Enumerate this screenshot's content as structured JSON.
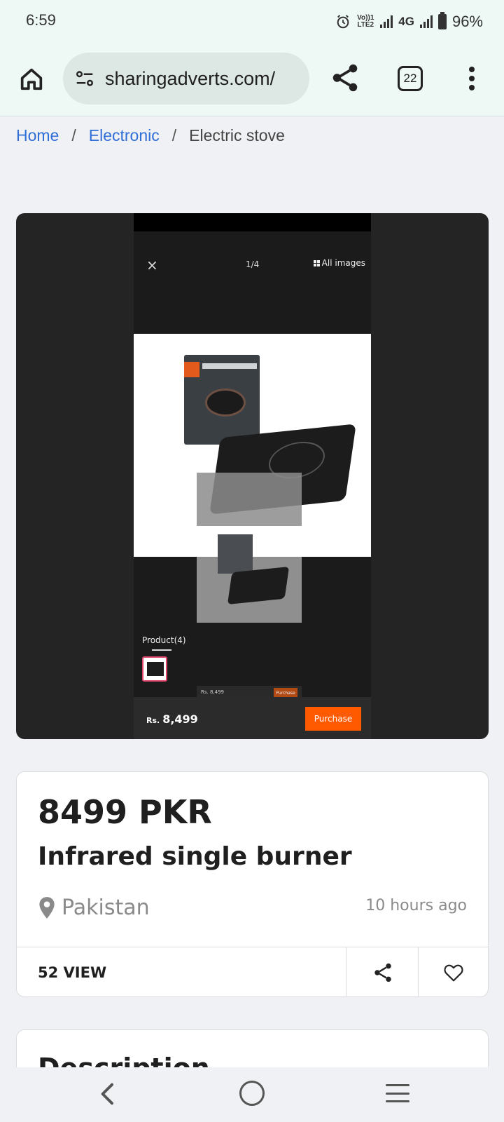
{
  "status_bar": {
    "time": "6:59",
    "volte_label": "Vo))1 LTE2",
    "network": "4G",
    "battery": "96%",
    "icons": [
      "alarm-icon",
      "signal-icon",
      "battery-icon"
    ]
  },
  "browser": {
    "url": "sharingadverts.com/",
    "tab_count": "22",
    "icons": [
      "home-icon",
      "site-settings-icon",
      "share-icon",
      "tabs-icon",
      "more-menu-icon"
    ]
  },
  "breadcrumb": {
    "items": [
      "Home",
      "Electronic"
    ],
    "current": "Electric stove",
    "separator": "/"
  },
  "embedded_image": {
    "close": "×",
    "counter": "1/4",
    "all_images": "All images",
    "product_count": "Product(4)",
    "mini_price": "Rs. 8,499",
    "mini_purchase": "Purchase",
    "price_currency": "Rs.",
    "price_amount": "8,499",
    "purchase_label": "Purchase",
    "colors": {
      "purchase": "#ff5a00",
      "background": "#242424"
    }
  },
  "listing": {
    "price": "8499 PKR",
    "title": "Infrared single burner",
    "location": "Pakistan",
    "posted": "10 hours ago",
    "views": "52 VIEW"
  },
  "description": {
    "heading": "Description"
  },
  "colors": {
    "link": "#2f6fd6",
    "toolbar_bg": "#eef9f6",
    "page_bg": "#f0f1f4"
  }
}
